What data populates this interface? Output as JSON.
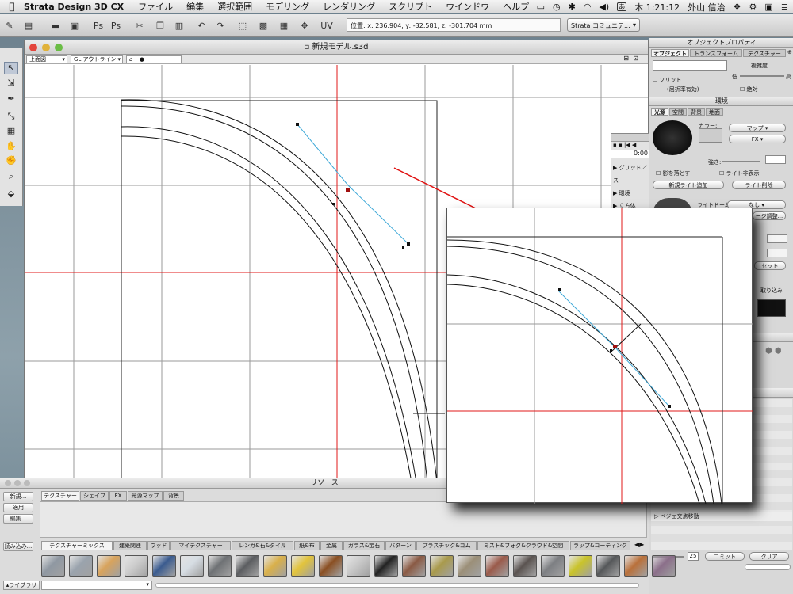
{
  "menubar": {
    "app_name": "Strata Design 3D CX",
    "items": [
      "ファイル",
      "編集",
      "選択範囲",
      "モデリング",
      "レンダリング",
      "スクリプト",
      "ウインドウ",
      "ヘルプ"
    ],
    "clock": "木 1:21:12",
    "user": "外山 信治",
    "input_method": "あ"
  },
  "toolbar": {
    "coordinates": "位置: x: 236.904, y: -32.581, z: -301.704 mm",
    "community_label": "Strata コミュニテ..."
  },
  "model_window": {
    "title": "新規モデル.s3d",
    "view_select": "上面図",
    "render_select": "GL アウトライン"
  },
  "timeline": {
    "time": "0:00",
    "tree_items": [
      "グリッド／ス",
      "環境",
      "立方体"
    ]
  },
  "object_props": {
    "title": "オブジェクトプロパティ",
    "tabs": [
      "オブジェクト",
      "トランスフォーム",
      "テクスチャー"
    ],
    "complexity_label": "複雑度",
    "low": "低",
    "high": "高",
    "solid": "ソリッド",
    "refraction": "(屈折率有効)",
    "absolute": "絶対"
  },
  "environment": {
    "title": "環境",
    "tabs": [
      "光源",
      "空間",
      "背景",
      "地面"
    ],
    "color_label": "カラー:",
    "map_select": "マップ",
    "fx_select": "FX",
    "intensity_label": "強さ:",
    "cast_shadow": "影を落とす",
    "hide_light": "ライト非表示",
    "add_light": "新規ライト追加",
    "delete_light": "ライト削除",
    "light_dome_label": "ライトドーム:",
    "light_dome_value": "なし",
    "image_adjust": "ージ調整..."
  },
  "partial_right": {
    "load": "取り込み",
    "reset": "セット"
  },
  "history": {
    "items": [
      "ベジェ交点移動"
    ],
    "step": "25",
    "commit": "コミット",
    "clear": "クリア"
  },
  "resources": {
    "title": "リソース",
    "buttons": [
      "新規...",
      "適用",
      "編集..."
    ],
    "import_button": "読み込み...",
    "library_button": "ライブラリ",
    "tabs": [
      "テクスチャー",
      "シェイプ",
      "FX",
      "光源マップ",
      "背景"
    ],
    "categories": [
      "テクスチャーミックス",
      "建築関連",
      "ウッド",
      "マイテクスチャー",
      "レンガ&石&タイル",
      "紙&布",
      "金属",
      "ガラス&宝石",
      "パターン",
      "プラスチック&ゴム",
      "ミスト&フォグ&クラウド&空間",
      "ラップ&コーティング"
    ]
  },
  "swatches": [
    {
      "name": "steel-plate",
      "color": "#8f98a2"
    },
    {
      "name": "brushed-metal",
      "color": "#9aa3ad"
    },
    {
      "name": "wood-light",
      "color": "#d8a35c"
    },
    {
      "name": "checker",
      "color": "#cccccc"
    },
    {
      "name": "blue-sphere",
      "color": "#3a5b8f"
    },
    {
      "name": "chrome",
      "color": "#d6dde3"
    },
    {
      "name": "dark-slate",
      "color": "#6e7174"
    },
    {
      "name": "graphite",
      "color": "#5b5d60"
    },
    {
      "name": "gold-plate",
      "color": "#d9b04a"
    },
    {
      "name": "gold",
      "color": "#e2c33c"
    },
    {
      "name": "rust-pattern",
      "color": "#8a4f22"
    },
    {
      "name": "silver",
      "color": "#c8c8c8"
    },
    {
      "name": "black-white-check",
      "color": "#222222"
    },
    {
      "name": "brown-tile",
      "color": "#8a5a44"
    },
    {
      "name": "olive-stripes",
      "color": "#a99a4c"
    },
    {
      "name": "cobblestone",
      "color": "#9b8f78"
    },
    {
      "name": "brick-red",
      "color": "#9a5a4a"
    },
    {
      "name": "dark-cobble",
      "color": "#5a5350"
    },
    {
      "name": "diamond-plate",
      "color": "#7d7f83"
    },
    {
      "name": "yellow-plastic",
      "color": "#c9c32a"
    },
    {
      "name": "dark-plate",
      "color": "#555759"
    },
    {
      "name": "copper",
      "color": "#b9703a"
    },
    {
      "name": "mosaic",
      "color": "#8b6f8a"
    }
  ],
  "colors": {
    "guide_red": "#e01818",
    "handle_blue": "#3fa9d8",
    "arrow_red": "#e01010"
  }
}
